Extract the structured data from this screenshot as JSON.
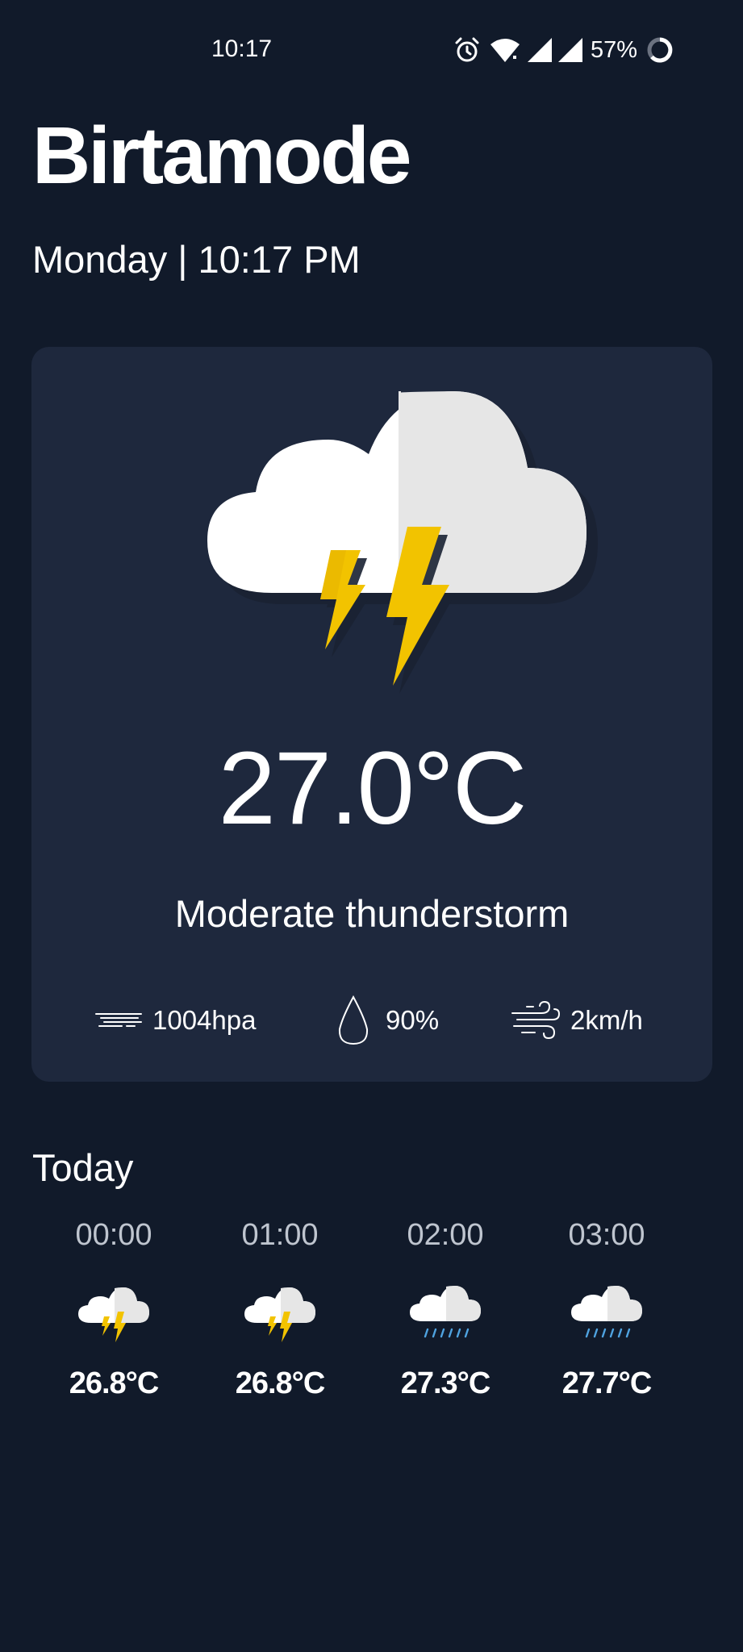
{
  "status_bar": {
    "time": "10:17",
    "battery": "57%",
    "icons": [
      "alarm-icon",
      "wifi-icon",
      "signal-icon",
      "signal-icon",
      "battery-ring-icon"
    ]
  },
  "location": {
    "city": "Birtamode",
    "datetime": "Monday | 10:17 PM"
  },
  "current": {
    "icon": "thunderstorm-icon",
    "temperature": "27.0°C",
    "condition": "Moderate thunderstorm",
    "pressure": "1004hpa",
    "humidity": "90%",
    "wind": "2km/h"
  },
  "today": {
    "title": "Today",
    "hours": [
      {
        "time": "00:00",
        "icon": "thunderstorm-icon",
        "temp": "26.8°C"
      },
      {
        "time": "01:00",
        "icon": "thunderstorm-icon",
        "temp": "26.8°C"
      },
      {
        "time": "02:00",
        "icon": "rain-icon",
        "temp": "27.3°C"
      },
      {
        "time": "03:00",
        "icon": "rain-icon",
        "temp": "27.7°C"
      }
    ]
  },
  "colors": {
    "background": "#111a2a",
    "card": "#1e283d",
    "cloud": "#ffffff",
    "cloud_shade": "#e8e8e8",
    "bolt": "#f2c300",
    "rain": "#4fa3e0"
  }
}
